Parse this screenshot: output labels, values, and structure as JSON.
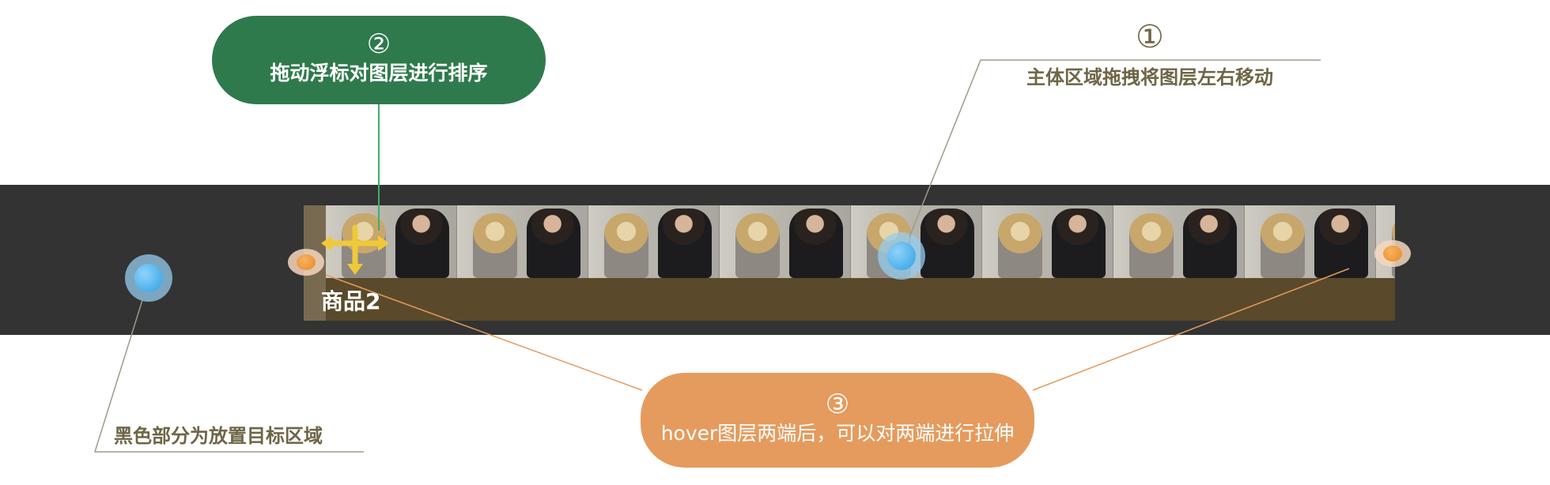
{
  "clip": {
    "label": "商品2",
    "frame_count": 9
  },
  "annotations": {
    "drag_sort": {
      "number": "②",
      "text": "拖动浮标对图层进行排序"
    },
    "move": {
      "number": "①",
      "text": "主体区域拖拽将图层左右移动"
    },
    "stretch": {
      "number": "③",
      "text": "hover图层两端后，可以对两端进行拉伸"
    },
    "drop_zone": {
      "text": "黑色部分为放置目标区域"
    }
  },
  "colors": {
    "track": "#333333",
    "clip": "#5a4a2b",
    "bubble_green": "#2f7a4d",
    "bubble_orange": "#e59b5d",
    "note_text": "#6e6545",
    "handle": "#e8892b",
    "marker": "#2f9fe3",
    "move_icon": "#f0c93a"
  },
  "icons": {
    "move": "move-arrows-icon",
    "handle": "resize-handle-icon",
    "marker": "pointer-marker-icon"
  }
}
